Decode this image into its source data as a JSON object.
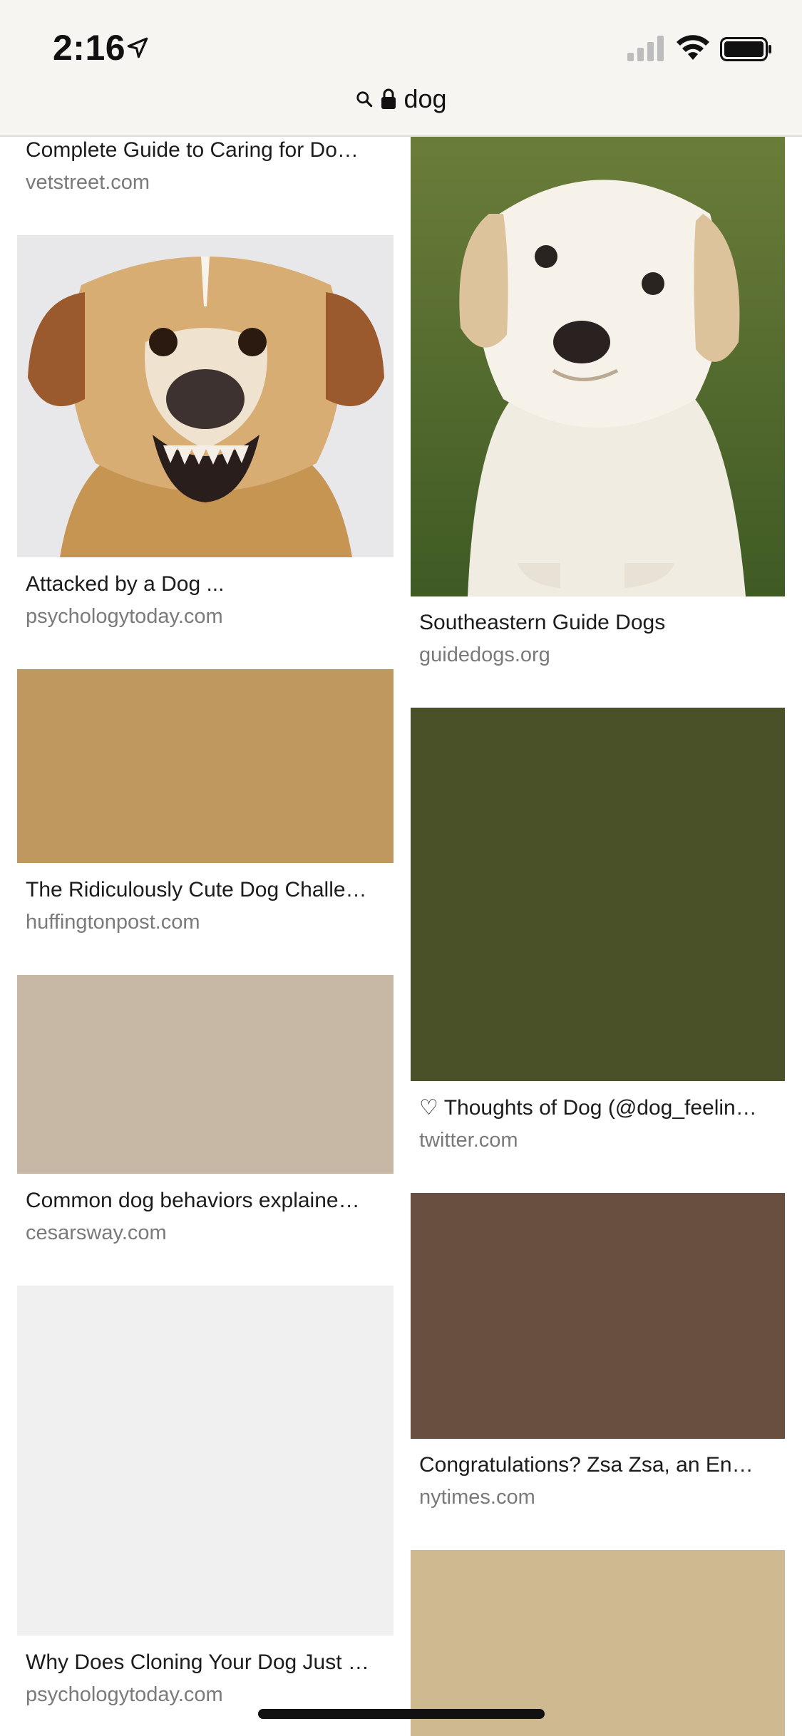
{
  "status_bar": {
    "time": "2:16",
    "icons": [
      "location-arrow-icon",
      "cellular-signal-icon",
      "wifi-icon",
      "battery-icon"
    ]
  },
  "url_bar": {
    "query": "dog",
    "icons": [
      "search-icon",
      "lock-icon"
    ]
  },
  "results": {
    "left": [
      {
        "title": "Complete Guide to Caring for Do…",
        "source": "vetstreet.com"
      },
      {
        "title": "Attacked by a Dog ...",
        "source": "psychologytoday.com",
        "image": "angry-dog-photo"
      },
      {
        "title": "The Ridiculously Cute Dog Challe…",
        "source": "huffingtonpost.com",
        "color": "#bf9860"
      },
      {
        "title": "Common dog behaviors explaine…",
        "source": "cesarsway.com",
        "color": "#c6b8a4"
      },
      {
        "title": "Why Does Cloning Your Dog Just …",
        "source": "psychologytoday.com",
        "color": "#f0f0f0"
      }
    ],
    "right": [
      {
        "title": "Southeastern Guide Dogs",
        "source": "guidedogs.org",
        "image": "white-puppy-photo"
      },
      {
        "title": "♡ Thoughts of Dog (@dog_feelin…",
        "source": "twitter.com",
        "color": "#4a5028"
      },
      {
        "title": "Congratulations? Zsa Zsa, an En…",
        "source": "nytimes.com",
        "color": "#684f3f"
      },
      {
        "color": "#cfb991"
      }
    ]
  },
  "colors": {
    "topbar_bg": "#f6f5f2",
    "source_text": "#7a7a7a"
  }
}
